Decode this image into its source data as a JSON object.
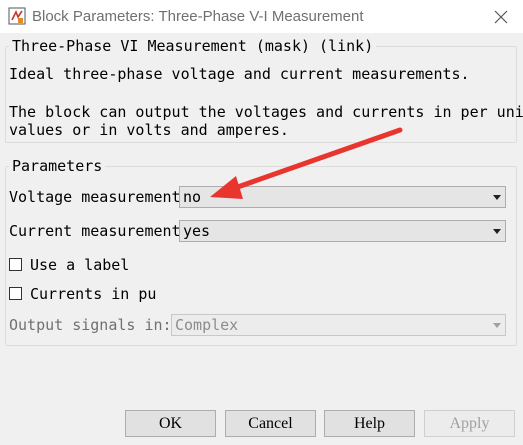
{
  "window": {
    "title": "Block Parameters: Three-Phase V-I Measurement",
    "icon": "simulink-block-icon",
    "close_icon": "close-icon"
  },
  "description": {
    "legend": "Three-Phase VI Measurement (mask) (link)",
    "line1": "Ideal three-phase voltage and current measurements.",
    "line2": "The block can output the voltages and currents in per unit",
    "line3": "values or in volts and amperes."
  },
  "parameters": {
    "legend": "Parameters",
    "voltage_measurement": {
      "label": "Voltage measurement",
      "value": "no"
    },
    "current_measurement": {
      "label": "Current measurement",
      "value": "yes"
    },
    "use_label": {
      "label": "Use a label",
      "checked": false
    },
    "currents_in_pu": {
      "label": "Currents in pu",
      "checked": false
    },
    "output_signals": {
      "label": "Output signals in:",
      "value": "Complex",
      "enabled": false
    }
  },
  "buttons": {
    "ok": "OK",
    "cancel": "Cancel",
    "help": "Help",
    "apply": "Apply"
  },
  "annotation": {
    "color": "#e8362f"
  }
}
